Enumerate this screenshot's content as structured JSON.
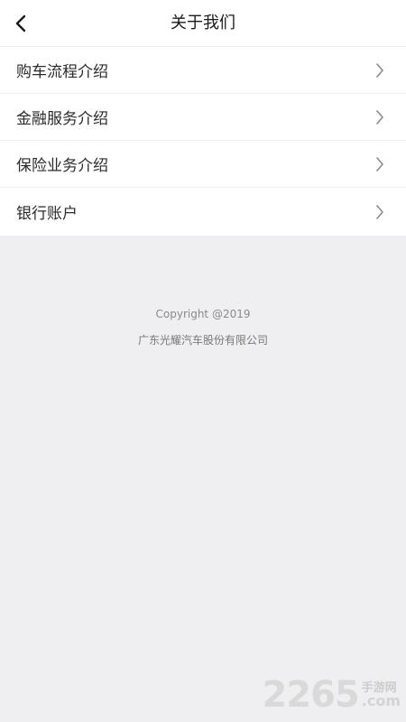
{
  "header": {
    "title": "关于我们",
    "back_icon": "chevron-left-icon"
  },
  "menu": {
    "items": [
      {
        "label": "购车流程介绍",
        "icon": "chevron-right-icon"
      },
      {
        "label": "金融服务介绍",
        "icon": "chevron-right-icon"
      },
      {
        "label": "保险业务介绍",
        "icon": "chevron-right-icon"
      },
      {
        "label": "银行账户",
        "icon": "chevron-right-icon"
      }
    ]
  },
  "footer": {
    "copyright": "Copyright @2019",
    "company": "广东光耀汽车股份有限公司"
  },
  "watermark": {
    "number": "2265",
    "name": "手游网",
    "domain": ".com"
  },
  "colors": {
    "page_background": "#efeff1",
    "surface": "#ffffff",
    "chevron": "#8c8c8c"
  }
}
